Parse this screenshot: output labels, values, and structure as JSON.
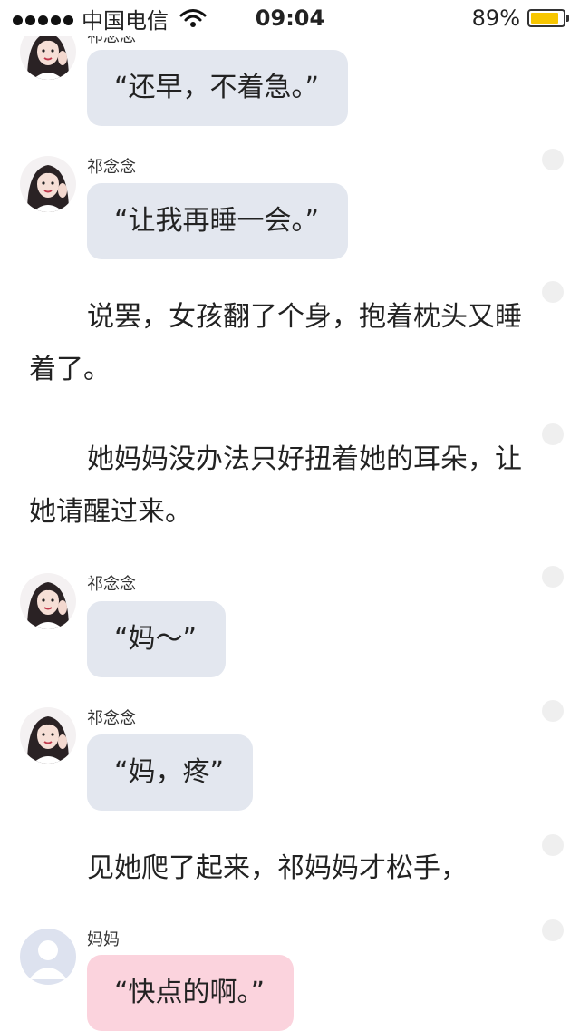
{
  "status_bar": {
    "carrier": "中国电信",
    "time": "09:04",
    "battery_percent": "89%",
    "battery_level": 0.89,
    "icons": [
      "signal-dots-icon",
      "wifi-icon",
      "battery-icon"
    ],
    "battery_color": "#f7c600"
  },
  "messages": [
    {
      "sender": "祁念念",
      "text": "“还早，不着急。”"
    },
    {
      "sender": "祁念念",
      "text": "“让我再睡一会。”"
    },
    {
      "sender": "祁念念",
      "text": "“妈～”"
    },
    {
      "sender": "祁念念",
      "text": "“妈，疼”"
    },
    {
      "sender": "妈妈",
      "text": "“快点的啊。”"
    }
  ],
  "narration": [
    "说罢，女孩翻了个身，抱着枕头又睡着了。",
    "她妈妈没办法只好扭着她的耳朵，让她请醒过来。",
    "见她爬了起来，祁妈妈才松手，"
  ],
  "colors": {
    "bubble_default": "#e3e7ef",
    "bubble_mom": "#fbd3dd",
    "side_dot": "#efefef"
  }
}
